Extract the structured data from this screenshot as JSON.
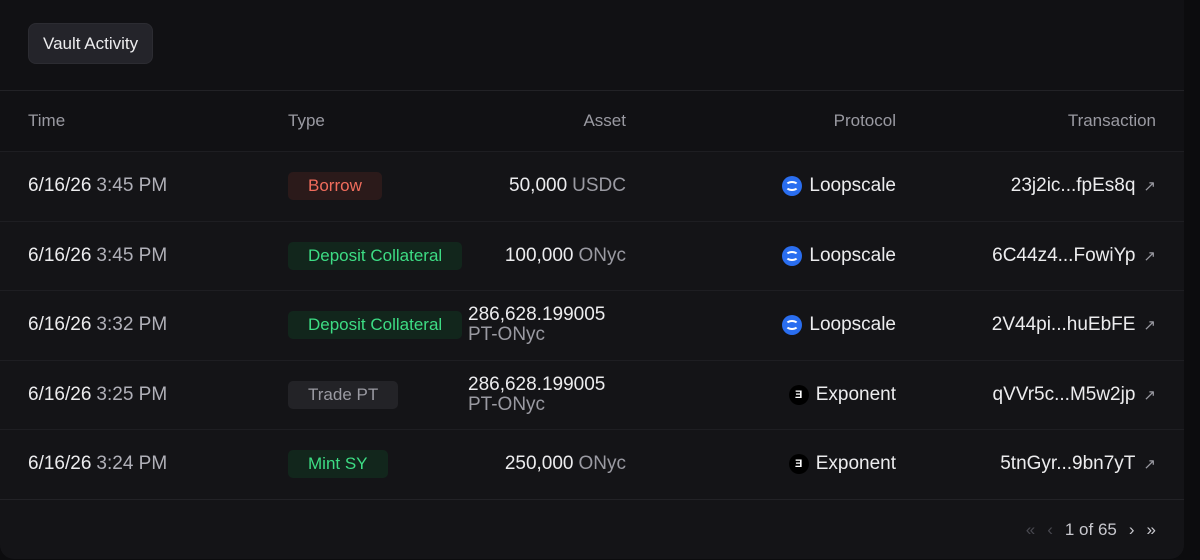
{
  "header": {
    "tab_label": "Vault Activity"
  },
  "columns": {
    "time": "Time",
    "type": "Type",
    "asset": "Asset",
    "protocol": "Protocol",
    "transaction": "Transaction"
  },
  "rows": [
    {
      "date": "6/16/26",
      "clock": "3:45 PM",
      "type": "Borrow",
      "amount": "50,000",
      "unit": "USDC",
      "protocol": "Loopscale",
      "tx": "23j2ic...fpEs8q"
    },
    {
      "date": "6/16/26",
      "clock": "3:45 PM",
      "type": "Deposit Collateral",
      "amount": "100,000",
      "unit": "ONyc",
      "protocol": "Loopscale",
      "tx": "6C44z4...FowiYp"
    },
    {
      "date": "6/16/26",
      "clock": "3:32 PM",
      "type": "Deposit Collateral",
      "amount": "286,628.199005",
      "unit": "PT-ONyc",
      "protocol": "Loopscale",
      "tx": "2V44pi...huEbFE"
    },
    {
      "date": "6/16/26",
      "clock": "3:25 PM",
      "type": "Trade PT",
      "amount": "286,628.199005",
      "unit": "PT-ONyc",
      "protocol": "Exponent",
      "tx": "qVVr5c...M5w2jp"
    },
    {
      "date": "6/16/26",
      "clock": "3:24 PM",
      "type": "Mint SY",
      "amount": "250,000",
      "unit": "ONyc",
      "protocol": "Exponent",
      "tx": "5tnGyr...9bn7yT"
    }
  ],
  "pagination": {
    "first": "«",
    "prev": "‹",
    "label": "1 of 65",
    "next": "›",
    "last": "»"
  },
  "icons": {
    "loopscale": "loopscale-logo-icon",
    "exponent": "exponent-logo-icon",
    "external": "external-link-icon"
  },
  "colors": {
    "borrow": "#f06c5c",
    "deposit": "#3ddc84",
    "loopscale": "#2a6ef0"
  }
}
